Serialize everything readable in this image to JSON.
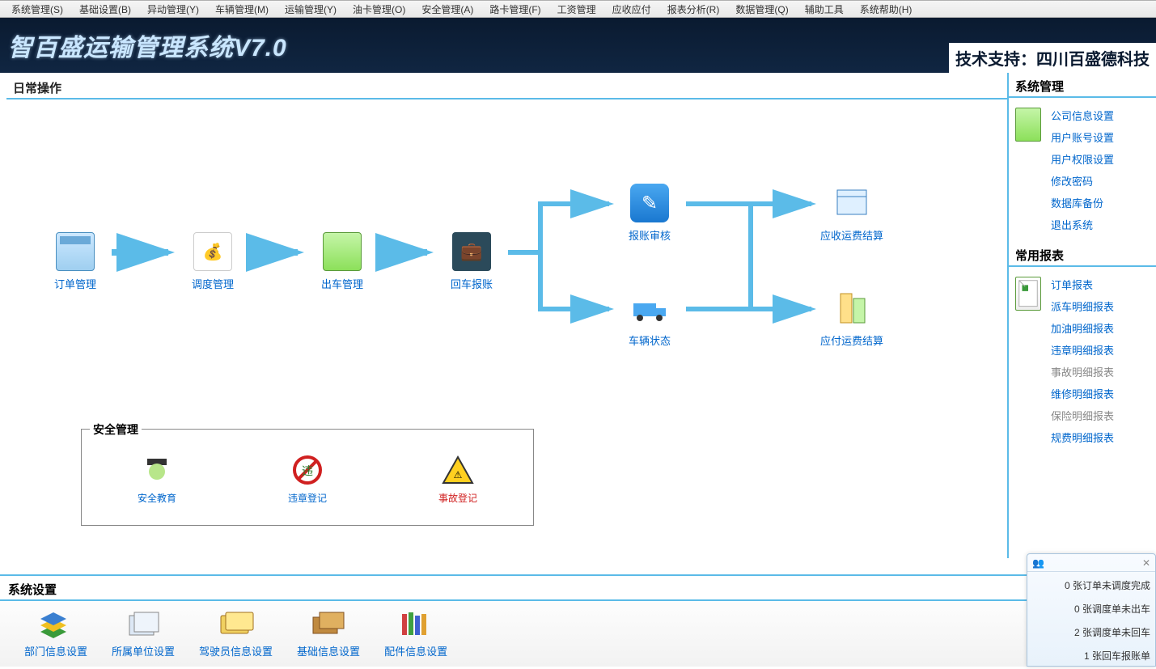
{
  "menu": [
    "系统管理(S)",
    "基础设置(B)",
    "异动管理(Y)",
    "车辆管理(M)",
    "运输管理(Y)",
    "油卡管理(O)",
    "安全管理(A)",
    "路卡管理(F)",
    "工资管理",
    "应收应付",
    "报表分析(R)",
    "数据管理(Q)",
    "辅助工具",
    "系统帮助(H)"
  ],
  "header": {
    "title": "智百盛运输管理系统V7.0",
    "support": "技术支持：四川百盛德科技"
  },
  "daily": {
    "title": "日常操作",
    "items": {
      "order": "订单管理",
      "dispatch": "调度管理",
      "depart": "出车管理",
      "return": "回车报账",
      "audit": "报账审核",
      "vehicle": "车辆状态",
      "receivable": "应收运费结算",
      "payable": "应付运费结算"
    }
  },
  "safety": {
    "title": "安全管理",
    "edu": "安全教育",
    "violation": "违章登记",
    "accident": "事故登记"
  },
  "right": {
    "sys_title": "系统管理",
    "sys_links": [
      "公司信息设置",
      "用户账号设置",
      "用户权限设置",
      "修改密码",
      "数据库备份",
      "退出系统"
    ],
    "rep_title": "常用报表",
    "rep_links": [
      "订单报表",
      "派车明细报表",
      "加油明细报表",
      "违章明细报表",
      "事故明细报表",
      "维修明细报表",
      "保险明细报表",
      "规费明细报表"
    ]
  },
  "bottom": {
    "title": "系统设置",
    "items": [
      "部门信息设置",
      "所属单位设置",
      "驾驶员信息设置",
      "基础信息设置",
      "配件信息设置"
    ]
  },
  "notify": {
    "lines": [
      "0 张订单未调度完成",
      "0 张调度单未出车",
      "2 张调度单未回车",
      "1 张回车报账单"
    ]
  }
}
